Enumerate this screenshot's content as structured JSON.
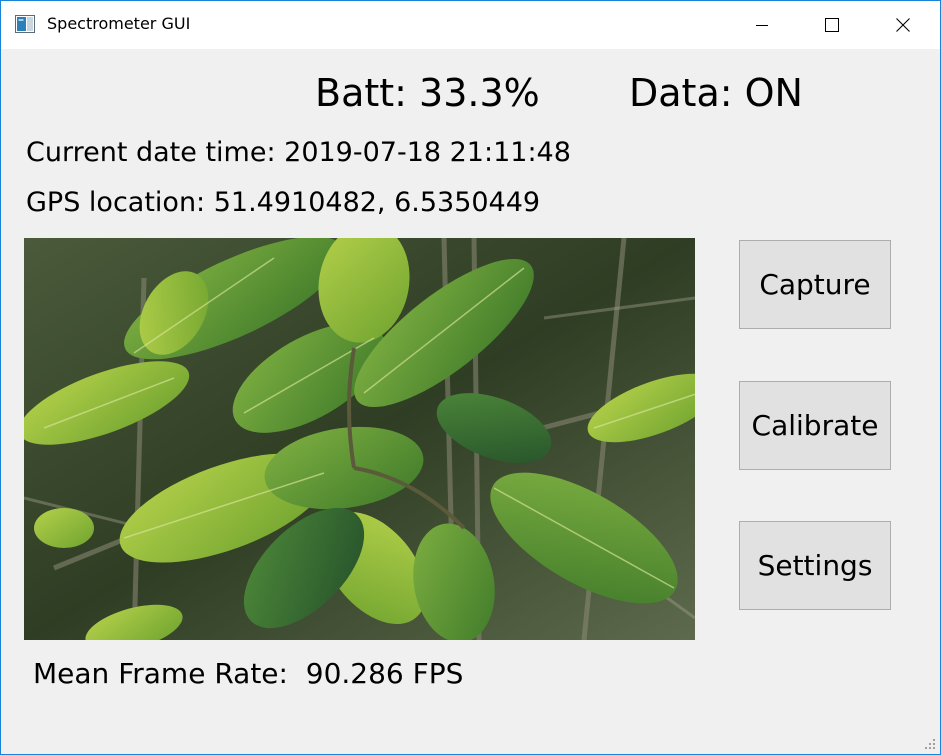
{
  "window": {
    "title": "Spectrometer GUI",
    "controls": [
      "minimize",
      "maximize",
      "close"
    ]
  },
  "status": {
    "battery": "Batt: 33.3%",
    "data": "Data: ON"
  },
  "info": {
    "datetime": "Current date time: 2019-07-18 21:11:48",
    "gps": "GPS location: 51.4910482, 6.5350449"
  },
  "camera": {
    "subject": "live camera preview of green leaves"
  },
  "buttons": {
    "capture": "Capture",
    "calibrate": "Calibrate",
    "settings": "Settings"
  },
  "footer": {
    "fps_label": "Mean Frame Rate:  90.286 FPS"
  },
  "icons": {
    "app": "app-window-icon",
    "minimize": "minimize-icon",
    "maximize": "maximize-icon",
    "close": "close-icon",
    "grip": "resize-grip-icon"
  },
  "colors": {
    "window_bg": "#f0f0f0",
    "titlebar_bg": "#ffffff",
    "window_border": "#1883d7",
    "button_bg": "#e1e1e1",
    "button_border": "#adadad"
  }
}
